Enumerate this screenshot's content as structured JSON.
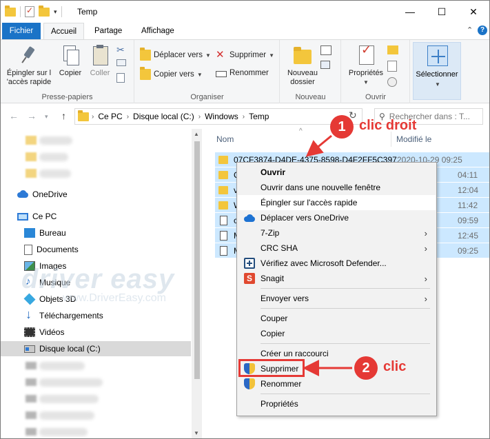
{
  "window": {
    "title": "Temp",
    "controls": {
      "minimize": "—",
      "maximize": "☐",
      "close": "✕"
    },
    "qat_arrow": "▾"
  },
  "ribbon_tabs": {
    "file": "Fichier",
    "home": "Accueil",
    "share": "Partage",
    "view": "Affichage",
    "chevron": "⌃",
    "help": "?"
  },
  "ribbon": {
    "clipboard": {
      "label": "Presse-papiers",
      "pin_line1": "Épingler sur l",
      "pin_line2": "'accès rapide",
      "copy": "Copier",
      "paste": "Coller"
    },
    "organize": {
      "label": "Organiser",
      "move_to": "Déplacer vers",
      "copy_to": "Copier vers",
      "delete": "Supprimer",
      "rename": "Renommer"
    },
    "new": {
      "label": "Nouveau",
      "new_folder_line1": "Nouveau",
      "new_folder_line2": "dossier"
    },
    "open": {
      "label": "Ouvrir",
      "properties": "Propriétés"
    },
    "select": {
      "label": "Sélectionner"
    }
  },
  "address": {
    "crumbs": [
      "Ce PC",
      "Disque local (C:)",
      "Windows",
      "Temp"
    ],
    "search_placeholder": "Rechercher dans : T..."
  },
  "nav": {
    "onedrive": "OneDrive",
    "this_pc": "Ce PC",
    "desktop": "Bureau",
    "documents": "Documents",
    "images": "Images",
    "music": "Musique",
    "objects3d": "Objets 3D",
    "downloads": "Téléchargements",
    "videos": "Vidéos",
    "local_disk": "Disque local (C:)"
  },
  "filelist": {
    "col_name": "Nom",
    "col_modified": "Modifié le",
    "rows": [
      {
        "name": "07CF3874-D4DE-4375-8598-D4F2FF5C397",
        "date": "2020-10-29 09:25"
      },
      {
        "name": "C",
        "date": "04:11"
      },
      {
        "name": "v",
        "date": "12:04"
      },
      {
        "name": "W",
        "date": "11:42"
      },
      {
        "name": "c",
        "date": "09:59"
      },
      {
        "name": "M",
        "date": "12:45"
      },
      {
        "name": "M",
        "date": "09:25"
      }
    ]
  },
  "watermark": {
    "brand": "driver easy",
    "url": "www.DriverEasy.com"
  },
  "context_menu": {
    "open": "Ouvrir",
    "open_new_window": "Ouvrir dans une nouvelle fenêtre",
    "pin_quick": "Épingler sur l'accès rapide",
    "move_onedrive": "Déplacer vers OneDrive",
    "sevenzip": "7-Zip",
    "crc_sha": "CRC SHA",
    "defender": "Vérifiez avec Microsoft Defender...",
    "snagit": "Snagit",
    "send_to": "Envoyer vers",
    "cut": "Couper",
    "copy": "Copier",
    "create_shortcut": "Créer un raccourci",
    "delete": "Supprimer",
    "rename": "Renommer",
    "properties": "Propriétés"
  },
  "annotations": {
    "step1_num": "1",
    "step1_text": "clic droit",
    "step2_num": "2",
    "step2_text": "clic",
    "color": "#e53935"
  }
}
